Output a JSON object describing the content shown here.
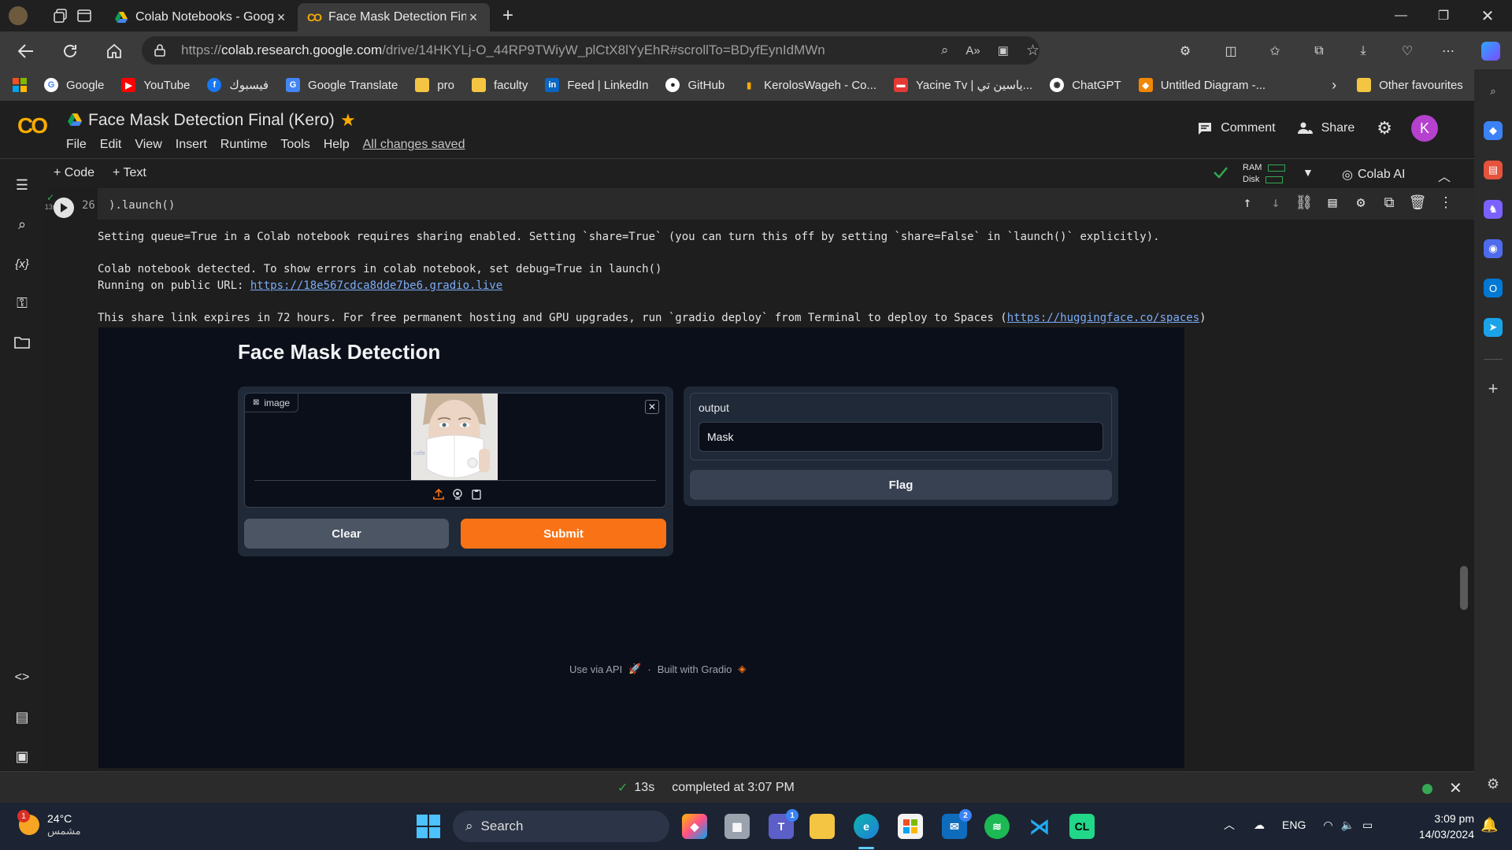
{
  "browser": {
    "tabs": [
      {
        "title": "Colab Notebooks - Google Drive",
        "active": false
      },
      {
        "title": "Face Mask Detection Final (Kero)",
        "active": true
      }
    ],
    "url_prefix": "https://",
    "url_domain": "colab.research.google.com",
    "url_path": "/drive/14HKYLj-O_44RP9TWiyW_plCtX8lYyEhR#scrollTo=BDyfEynIdMWn",
    "bookmarks": [
      {
        "label": "Google",
        "icon": "google-icon",
        "color": "#4285f4"
      },
      {
        "label": "YouTube",
        "icon": "youtube-icon",
        "color": "#ff0000"
      },
      {
        "label": "فيسبوك",
        "icon": "facebook-icon",
        "color": "#1877f2"
      },
      {
        "label": "Google Translate",
        "icon": "translate-icon",
        "color": "#4285f4"
      },
      {
        "label": "pro",
        "icon": "folder-icon",
        "color": "#f4c542"
      },
      {
        "label": "faculty",
        "icon": "folder-icon",
        "color": "#f4c542"
      },
      {
        "label": "Feed | LinkedIn",
        "icon": "linkedin-icon",
        "color": "#0a66c2"
      },
      {
        "label": "GitHub",
        "icon": "github-icon",
        "color": "#ffffff"
      },
      {
        "label": "KerolosWageh - Co...",
        "icon": "chart-icon",
        "color": "#f9ab00"
      },
      {
        "label": "Yacine Tv | ياسين تي...",
        "icon": "tv-icon",
        "color": "#e53935"
      },
      {
        "label": "ChatGPT",
        "icon": "chatgpt-icon",
        "color": "#10a37f"
      },
      {
        "label": "Untitled Diagram -...",
        "icon": "drawio-icon",
        "color": "#f08705"
      }
    ],
    "other_favourites": "Other favourites"
  },
  "colab": {
    "title": "Face Mask Detection Final (Kero)",
    "menu": [
      "File",
      "Edit",
      "View",
      "Insert",
      "Runtime",
      "Tools",
      "Help"
    ],
    "saved_status": "All changes saved",
    "comment": "Comment",
    "share": "Share",
    "avatar_letter": "K",
    "add_code": "+ Code",
    "add_text": "+ Text",
    "ram_label": "RAM",
    "disk_label": "Disk",
    "colab_ai": "Colab AI",
    "cell_exec_time": "13s",
    "line_number": "26",
    "code_line": ").launch()",
    "output_lines": {
      "l1": "Setting queue=True in a Colab notebook requires sharing enabled. Setting `share=True` (you can turn this off by setting `share=False` in `launch()` explicitly).",
      "l2": "Colab notebook detected. To show errors in colab notebook, set debug=True in launch()",
      "l3_prefix": "Running on public URL: ",
      "l3_link": "https://18e567cdca8dde7be6.gradio.live",
      "l4_prefix": "This share link expires in 72 hours. For free permanent hosting and GPU upgrades, run `gradio deploy` from Terminal to deploy to Spaces (",
      "l4_link": "https://huggingface.co/spaces",
      "l4_suffix": ")"
    }
  },
  "gradio": {
    "title": "Face Mask Detection",
    "image_label": "image",
    "clear_button": "Clear",
    "submit_button": "Submit",
    "output_label": "output",
    "output_value": "Mask",
    "flag_button": "Flag",
    "footer_api": "Use via API",
    "footer_sep": "·",
    "footer_built": "Built with Gradio",
    "photo_text": "cofe"
  },
  "status_bar": {
    "time": "13s",
    "message": "completed at 3:07 PM"
  },
  "taskbar": {
    "weather_temp": "24°C",
    "weather_condition": "مشمس",
    "weather_badge": "1",
    "search_placeholder": "Search",
    "language": "ENG",
    "time": "3:09 pm",
    "date": "14/03/2024",
    "teams_badge": "1",
    "mail_badge": "2"
  }
}
